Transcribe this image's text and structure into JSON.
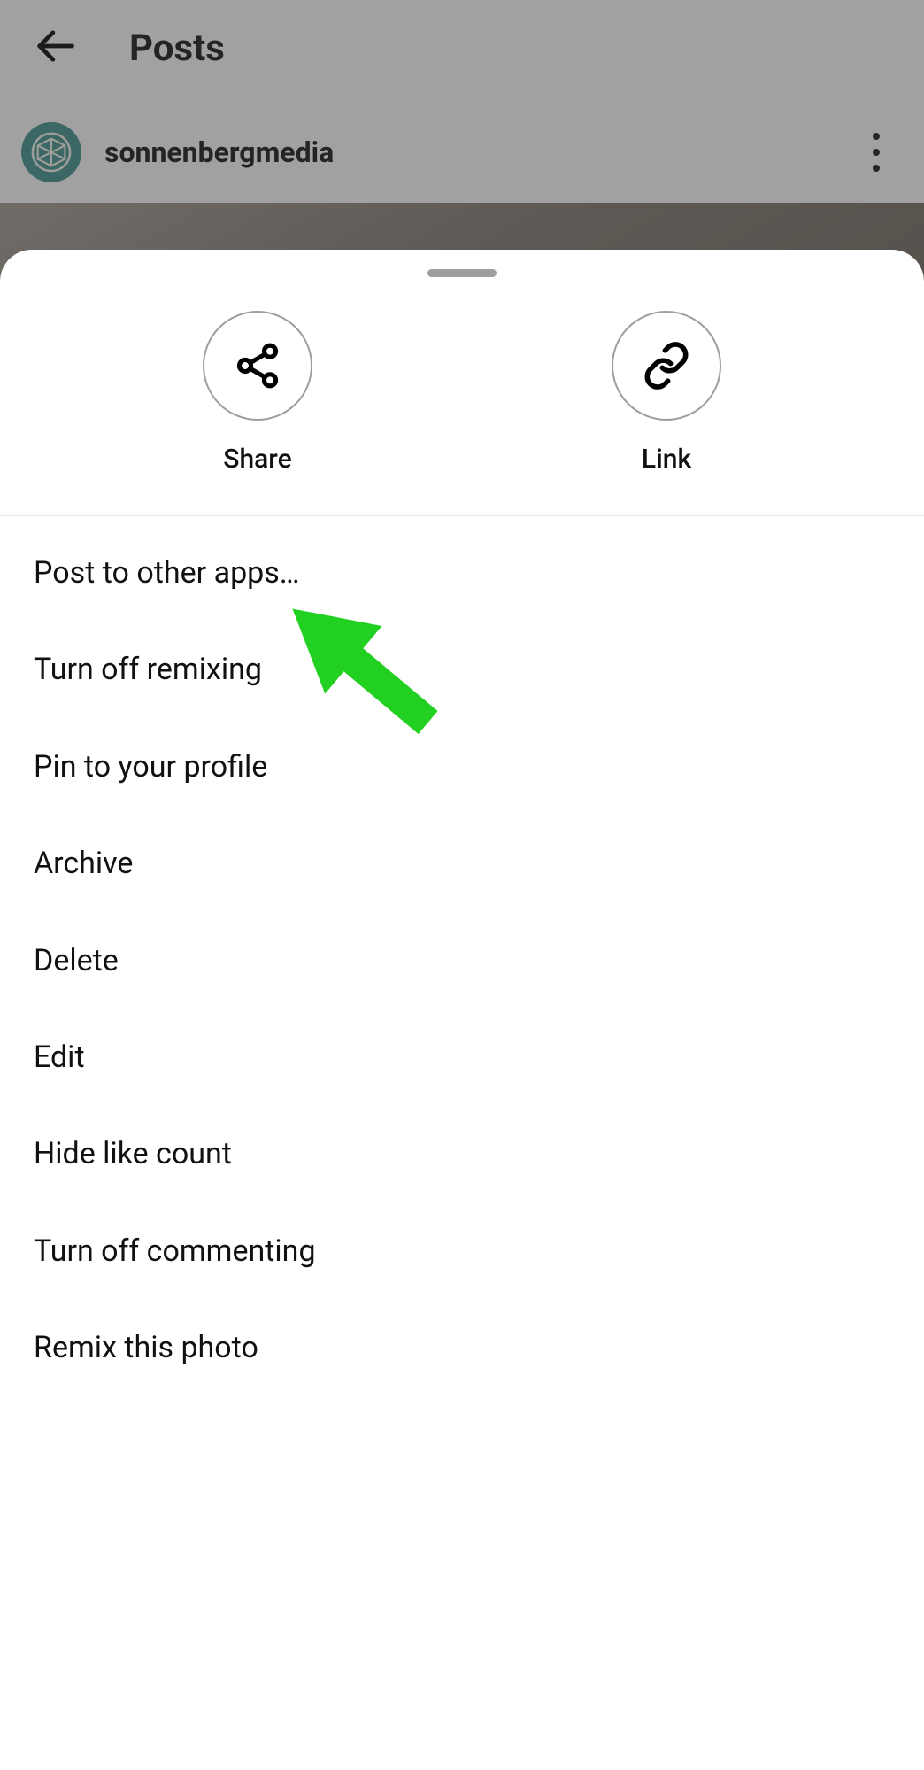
{
  "header": {
    "title": "Posts"
  },
  "profile": {
    "username": "sonnenbergmedia"
  },
  "sheet": {
    "roundActions": {
      "share": "Share",
      "link": "Link"
    },
    "menu": [
      "Post to other apps…",
      "Turn off remixing",
      "Pin to your profile",
      "Archive",
      "Delete",
      "Edit",
      "Hide like count",
      "Turn off commenting",
      "Remix this photo"
    ]
  },
  "colors": {
    "highlightArrow": "#22d022"
  }
}
